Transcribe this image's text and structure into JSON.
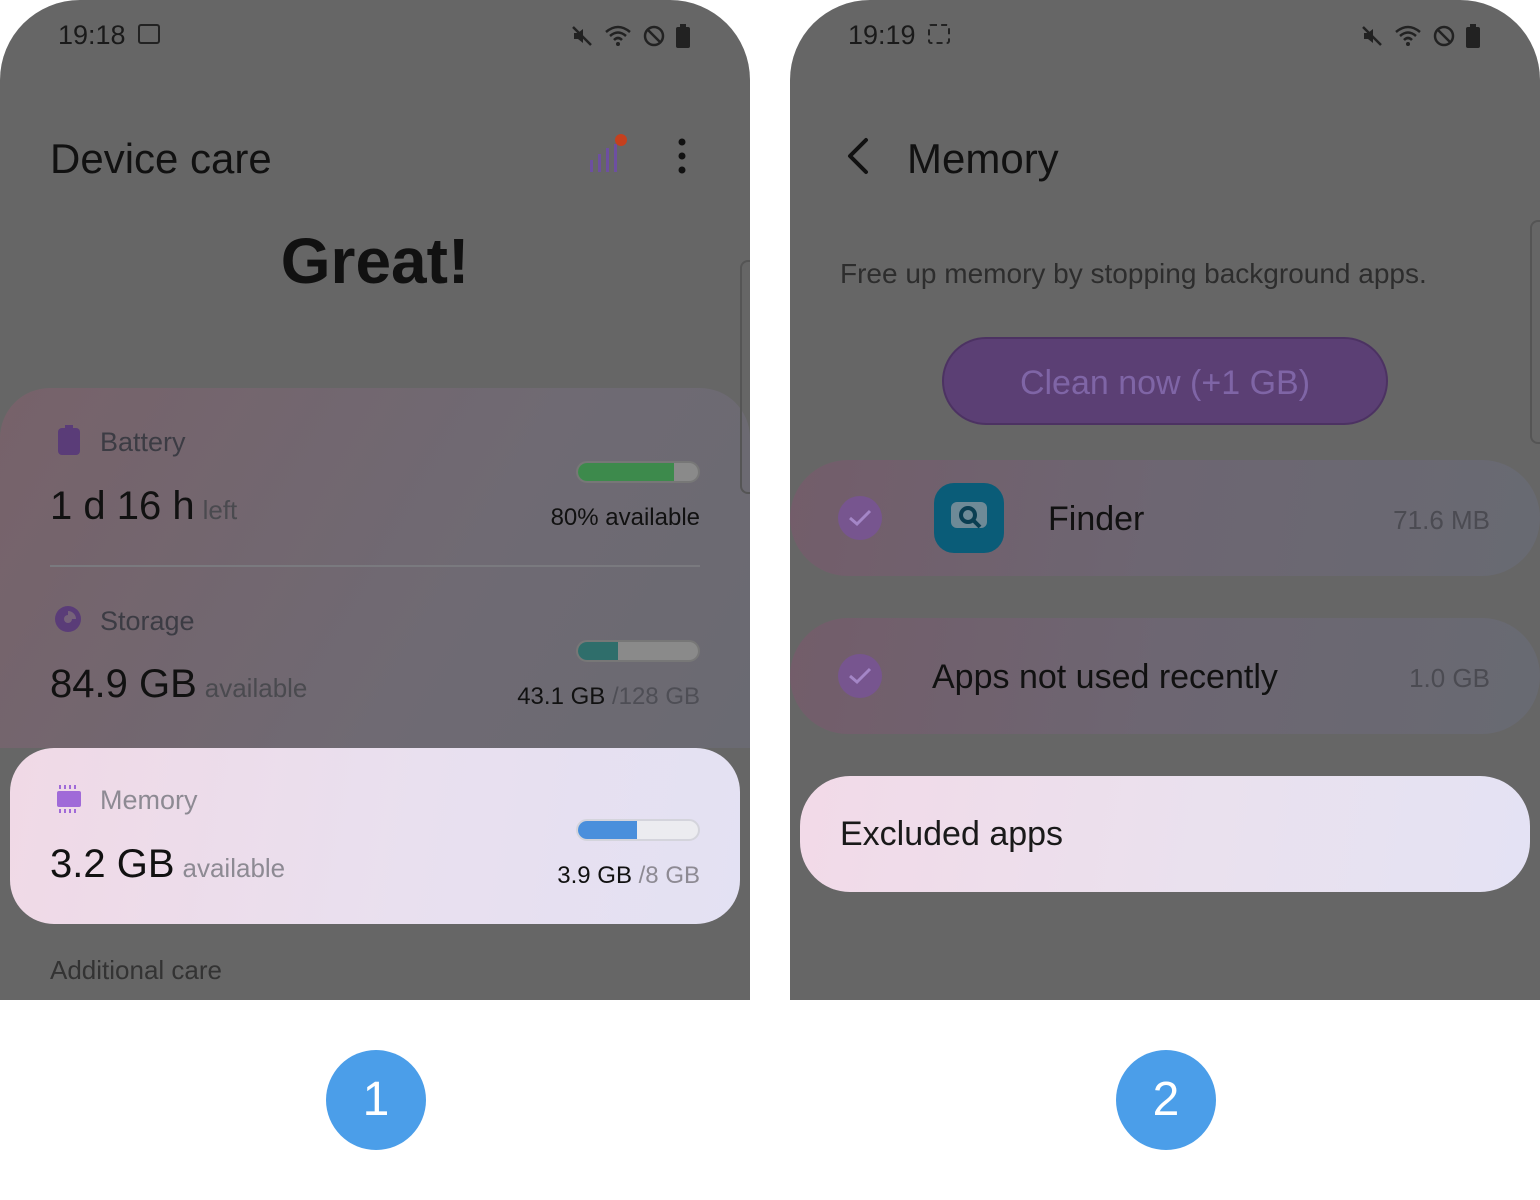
{
  "screen1": {
    "status": {
      "time": "19:18"
    },
    "title": "Device care",
    "headline": "Great!",
    "battery": {
      "label": "Battery",
      "value": "1 d 16 h",
      "suffix": "left",
      "bar_fraction": 0.8,
      "bar_text": "80% available",
      "bar_color": "#3d8a4c",
      "icon": "battery-icon"
    },
    "storage": {
      "label": "Storage",
      "value": "84.9 GB",
      "suffix": "available",
      "bar_fraction": 0.337,
      "used": "43.1 GB",
      "total": "/128 GB",
      "bar_color": "#2f6e6b",
      "icon": "storage-pie-icon"
    },
    "memory": {
      "label": "Memory",
      "value": "3.2 GB",
      "suffix": "available",
      "bar_fraction": 0.49,
      "used": "3.9 GB",
      "total": "/8 GB",
      "bar_color": "#4a8fdc",
      "icon": "memory-chip-icon"
    },
    "additional_care": "Additional care",
    "step": "1"
  },
  "screen2": {
    "status": {
      "time": "19:19"
    },
    "title": "Memory",
    "description": "Free up memory by stopping background apps.",
    "clean_button": "Clean now (+1 GB)",
    "rows": [
      {
        "title": "Finder",
        "size": "71.6 MB"
      },
      {
        "title": "Apps not used recently",
        "size": "1.0 GB"
      }
    ],
    "excluded_apps": "Excluded apps",
    "step": "2"
  }
}
